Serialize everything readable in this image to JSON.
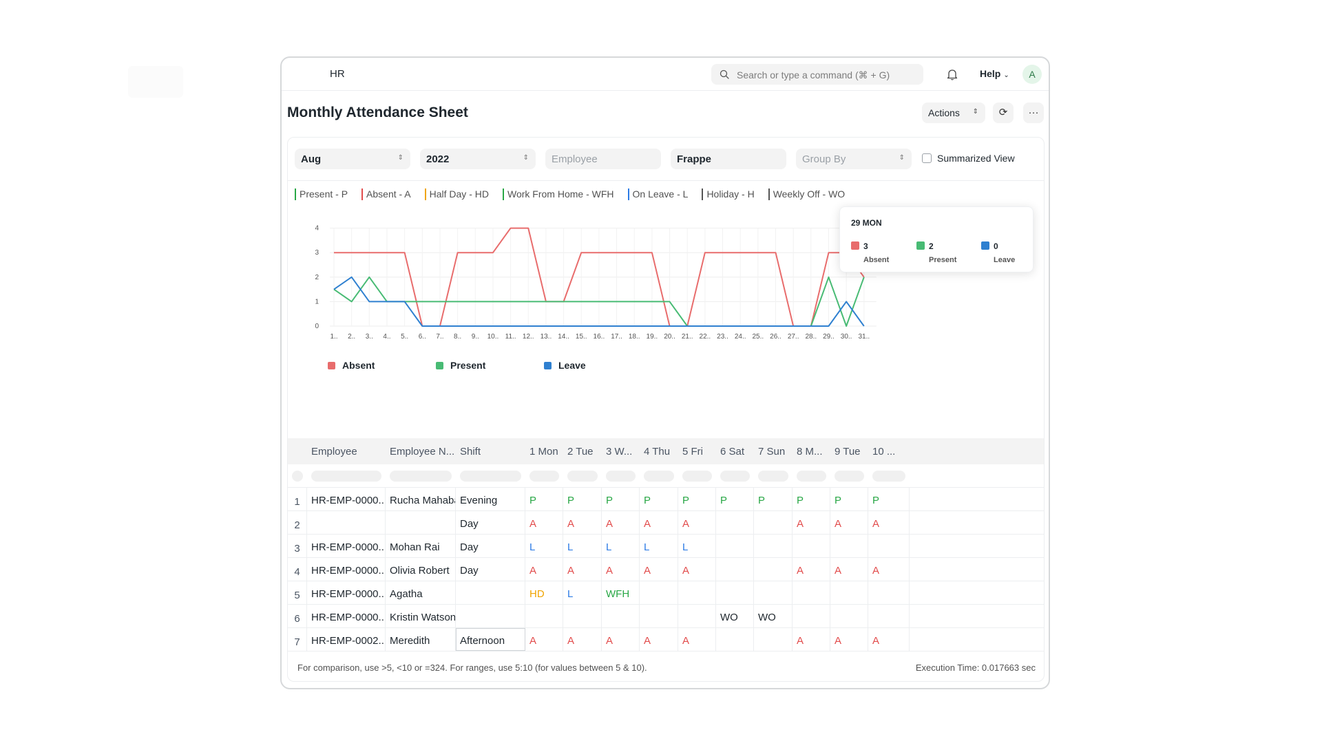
{
  "navbar": {
    "title": "HR",
    "search_placeholder": "Search or type a command (⌘ + G)",
    "help_label": "Help",
    "avatar_initial": "A"
  },
  "page": {
    "title": "Monthly Attendance Sheet",
    "actions_label": "Actions"
  },
  "filters": {
    "month": "Aug",
    "year": "2022",
    "employee_placeholder": "Employee",
    "company": "Frappe",
    "group_by_placeholder": "Group By",
    "summarized_view_label": "Summarized View"
  },
  "status_legend": [
    {
      "label": "Present - P",
      "color": "#28a745"
    },
    {
      "label": "Absent - A",
      "color": "#e24c4c"
    },
    {
      "label": "Half Day - HD",
      "color": "#f0a400"
    },
    {
      "label": "Work From Home - WFH",
      "color": "#28a745"
    },
    {
      "label": "On Leave - L",
      "color": "#2c7be5"
    },
    {
      "label": "Holiday - H",
      "color": "#555555"
    },
    {
      "label": "Weekly Off - WO",
      "color": "#555555"
    }
  ],
  "chart_data": {
    "type": "line",
    "x": [
      "1..",
      "2..",
      "3..",
      "4..",
      "5..",
      "6..",
      "7..",
      "8..",
      "9..",
      "10..",
      "11..",
      "12..",
      "13..",
      "14..",
      "15..",
      "16..",
      "17..",
      "18..",
      "19..",
      "20..",
      "21..",
      "22..",
      "23..",
      "24..",
      "25..",
      "26..",
      "27..",
      "28..",
      "29..",
      "30..",
      "31.."
    ],
    "ylim": [
      0,
      4
    ],
    "yticks": [
      0,
      1,
      2,
      3,
      4
    ],
    "grid": true,
    "legend_position": "bottom-left",
    "series": [
      {
        "name": "Absent",
        "color": "#e86c6c",
        "values": [
          3,
          3,
          3,
          3,
          3,
          0,
          0,
          3,
          3,
          3,
          4,
          4,
          1,
          1,
          3,
          3,
          3,
          3,
          3,
          0,
          0,
          3,
          3,
          3,
          3,
          3,
          0,
          0,
          3,
          3,
          2
        ]
      },
      {
        "name": "Present",
        "color": "#48bb74",
        "values": [
          1.5,
          1,
          2,
          1,
          1,
          1,
          1,
          1,
          1,
          1,
          1,
          1,
          1,
          1,
          1,
          1,
          1,
          1,
          1,
          1,
          0,
          0,
          0,
          0,
          0,
          0,
          0,
          0,
          2,
          0,
          2
        ]
      },
      {
        "name": "Leave",
        "color": "#2f80d0",
        "values": [
          1.5,
          2,
          1,
          1,
          1,
          0,
          0,
          0,
          0,
          0,
          0,
          0,
          0,
          0,
          0,
          0,
          0,
          0,
          0,
          0,
          0,
          0,
          0,
          0,
          0,
          0,
          0,
          0,
          0,
          1,
          0
        ]
      }
    ],
    "tooltip": {
      "title": "29 MON",
      "items": [
        {
          "value": "3",
          "label": "Absent",
          "color": "#e86c6c"
        },
        {
          "value": "2",
          "label": "Present",
          "color": "#48bb74"
        },
        {
          "value": "0",
          "label": "Leave",
          "color": "#2f80d0"
        }
      ]
    }
  },
  "table": {
    "columns": [
      "Employee",
      "Employee N...",
      "Shift",
      "1 Mon",
      "2 Tue",
      "3 W...",
      "4 Thu",
      "5 Fri",
      "6 Sat",
      "7 Sun",
      "8 M...",
      "9 Tue",
      "10 ..."
    ],
    "rows": [
      {
        "n": "1",
        "employee": "HR-EMP-0000...",
        "name": "Rucha Mahabal",
        "shift": "Evening",
        "days": [
          "P",
          "P",
          "P",
          "P",
          "P",
          "P",
          "P",
          "P",
          "P",
          "P"
        ]
      },
      {
        "n": "2",
        "employee": "",
        "name": "",
        "shift": "Day",
        "days": [
          "A",
          "A",
          "A",
          "A",
          "A",
          "",
          "",
          "A",
          "A",
          "A"
        ]
      },
      {
        "n": "3",
        "employee": "HR-EMP-0000...",
        "name": "Mohan Rai",
        "shift": "Day",
        "days": [
          "L",
          "L",
          "L",
          "L",
          "L",
          "",
          "",
          "",
          "",
          ""
        ]
      },
      {
        "n": "4",
        "employee": "HR-EMP-0000...",
        "name": "Olivia Robert",
        "shift": "Day",
        "days": [
          "A",
          "A",
          "A",
          "A",
          "A",
          "",
          "",
          "A",
          "A",
          "A"
        ]
      },
      {
        "n": "5",
        "employee": "HR-EMP-0000...",
        "name": "Agatha",
        "shift": "",
        "days": [
          "HD",
          "L",
          "WFH",
          "",
          "",
          "",
          "",
          "",
          "",
          ""
        ]
      },
      {
        "n": "6",
        "employee": "HR-EMP-0000...",
        "name": "Kristin Watson",
        "shift": "",
        "days": [
          "",
          "",
          "",
          "",
          "",
          "WO",
          "WO",
          "",
          "",
          ""
        ]
      },
      {
        "n": "7",
        "employee": "HR-EMP-0002...",
        "name": "Meredith",
        "shift": "Afternoon",
        "days": [
          "A",
          "A",
          "A",
          "A",
          "A",
          "",
          "",
          "A",
          "A",
          "A"
        ]
      }
    ]
  },
  "footer": {
    "note": "For comparison, use >5, <10 or =324. For ranges, use 5:10 (for values between 5 & 10).",
    "execution_time": "Execution Time: 0.017663 sec"
  }
}
